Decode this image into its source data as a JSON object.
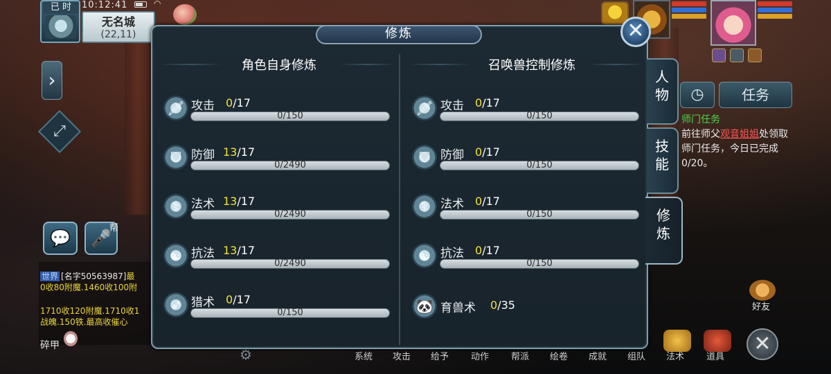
{
  "status": {
    "time_tag": "已 时",
    "clock": "10:12:41",
    "city": "无名城",
    "coords": "(22,11)"
  },
  "panel": {
    "title": "修炼",
    "left_section": {
      "title": "角色自身修炼",
      "rows": [
        {
          "icon": "sword-icon",
          "label": "攻击",
          "current": "0",
          "max": "/17",
          "progress_text": "0/150",
          "progress": 0
        },
        {
          "icon": "shield-icon",
          "label": "防御",
          "current": "13",
          "max": "/17",
          "progress_text": "0/2490",
          "progress": 0
        },
        {
          "icon": "staff-icon",
          "label": "法术",
          "current": "13",
          "max": "/17",
          "progress_text": "0/2490",
          "progress": 0
        },
        {
          "icon": "yin-yang-icon",
          "label": "抗法",
          "current": "13",
          "max": "/17",
          "progress_text": "0/2490",
          "progress": 0
        },
        {
          "icon": "bow-icon",
          "label": "猎术",
          "current": "0",
          "max": "/17",
          "progress_text": "0/150",
          "progress": 0
        }
      ]
    },
    "right_section": {
      "title": "召唤兽控制修炼",
      "rows": [
        {
          "icon": "sword-icon",
          "label": "攻击",
          "current": "0",
          "max": "/17",
          "progress_text": "0/150",
          "progress": 0
        },
        {
          "icon": "shield-icon",
          "label": "防御",
          "current": "0",
          "max": "/17",
          "progress_text": "0/150",
          "progress": 0
        },
        {
          "icon": "staff-icon",
          "label": "法术",
          "current": "0",
          "max": "/17",
          "progress_text": "0/150",
          "progress": 0
        },
        {
          "icon": "yin-yang-icon",
          "label": "抗法",
          "current": "0",
          "max": "/17",
          "progress_text": "0/150",
          "progress": 0
        },
        {
          "icon": "panda-icon",
          "label": "育兽术",
          "current": "0",
          "max": "/35"
        }
      ]
    },
    "tabs": [
      {
        "label": "人物",
        "active": false
      },
      {
        "label": "技能",
        "active": false
      },
      {
        "label": "修炼",
        "active": true
      }
    ]
  },
  "quest": {
    "timer_icon": "clock-icon",
    "task_button": "任务",
    "title": "师门任务",
    "text_before": "前往师父",
    "npc": "观音姐姐",
    "text_after": "处领取师门任务，今日已完成0/20。"
  },
  "chat": {
    "voice_tag": "帮",
    "world_tag": "世界",
    "name": "[名字50563987]",
    "line1_tail": "最",
    "line2": "0收80附魔.1460收100附",
    "line3": "1710收120附魔.1710收1",
    "line4": "战魄.150铁.最高收催心",
    "armor_label": "碎甲"
  },
  "right_side": {
    "friend_label": "好友",
    "close_label": "✕"
  },
  "bottom_bar": [
    "系统",
    "攻击",
    "给予",
    "动作",
    "帮派",
    "绘卷",
    "成就",
    "组队",
    "法术",
    "道具"
  ],
  "colors": {
    "accent_level": "#f3e13b",
    "quest_title": "#4cd94c",
    "quest_npc": "#ff5555"
  }
}
